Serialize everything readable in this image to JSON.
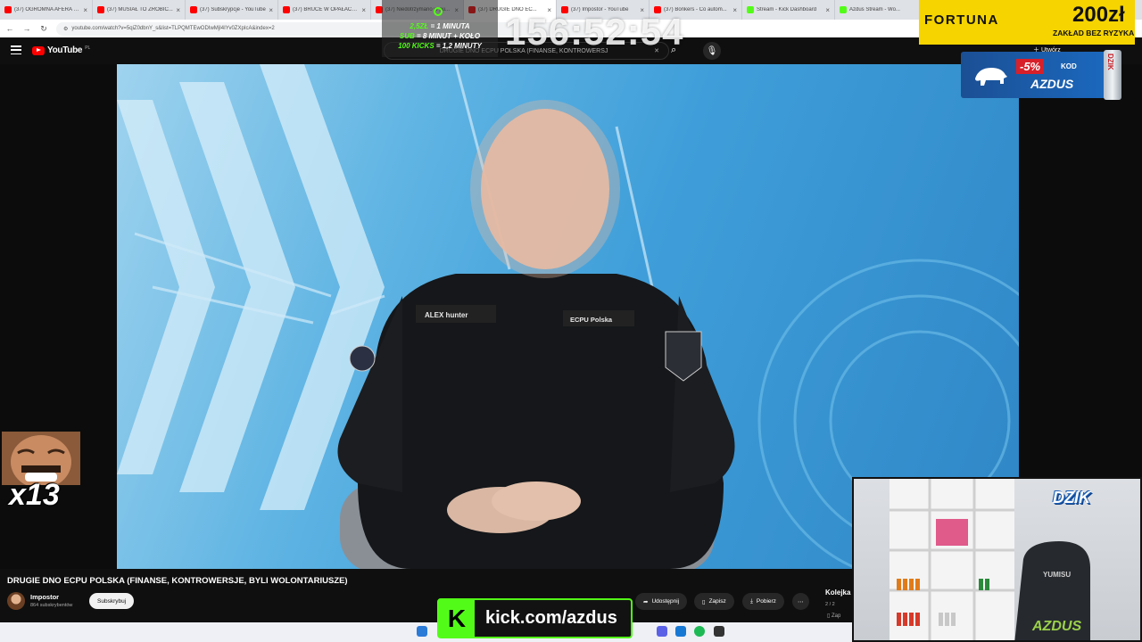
{
  "browser": {
    "tabs": [
      {
        "title": "(37) OGROMNA AFERA M...",
        "favicon": "youtube"
      },
      {
        "title": "(37) MUSIAŁ TO ZROBIĆ...",
        "favicon": "youtube"
      },
      {
        "title": "(37) Subskrypcje - YouTube",
        "favicon": "youtube"
      },
      {
        "title": "(37) BRUCE W OPAŁACH...",
        "favicon": "youtube"
      },
      {
        "title": "(37) Niedotrzymano w pu...",
        "favicon": "youtube"
      },
      {
        "title": "(37) DRUGIE DNO EC...",
        "favicon": "youtube"
      },
      {
        "title": "(37) Impostor - YouTube",
        "favicon": "youtube"
      },
      {
        "title": "(37) Bonkers - Co autom...",
        "favicon": "youtube"
      },
      {
        "title": "Stream - Kick Dashboard",
        "favicon": "kick"
      },
      {
        "title": "Azdus Stream - Wo...",
        "favicon": "kick"
      }
    ],
    "active_tab_index": 5,
    "url": "youtube.com/watch?v=5qiZ0dbnY_s&list=TLPQMTEwODIwMjI4IYv0ZXpIcA&index=2"
  },
  "youtube": {
    "logo_text": "YouTube",
    "logo_region": "PL",
    "search_query": "DRUGIE DNO ECPU POLSKA (FINANSE, KONTROWERSJ",
    "create_label": "Utwórz",
    "video_title": "DRUGIE DNO ECPU POLSKA (FINANSE, KONTROWERSJE, BYLI WOLONTARIUSZE)",
    "channel_name": "Impostor",
    "channel_subs": "864 subskrybentów",
    "subscribe_label": "Subskrybuj",
    "share_label": "Udostępnij",
    "save_label": "Zapisz",
    "download_label": "Pobierz",
    "more_label": "⋯",
    "queue_label": "Kolejka",
    "queue_position": "2 / 2",
    "queue_save_label": "Zap",
    "patch_left": "ALEX hunter",
    "patch_right": "ECPU Polska"
  },
  "overlay": {
    "goals": [
      {
        "prefix": "2,5ZŁ",
        "text": " = 1 MINUTA"
      },
      {
        "prefix": "SUB",
        "text": " = 8 MINUT + KOŁO"
      },
      {
        "prefix": "100 KICKS",
        "text": " = 1,2 MINUTY"
      }
    ],
    "timer": "156:52:54",
    "fortuna_brand": "FORTUNA",
    "fortuna_amount": "200zł",
    "fortuna_tagline": "ZAKŁAD BEZ RYZYKA",
    "promo_discount": "-5%",
    "promo_kod": "KOD",
    "promo_code": "AZDUS",
    "promo_can": "DZIK",
    "emote_count": "x13",
    "webcam_brand": "DZIK",
    "chair_brand_top": "YUMISU",
    "chair_brand_bottom": "AZDUS",
    "kick_icon": "K",
    "kick_url": "kick.com/azdus"
  },
  "colors": {
    "youtube_red": "#ff0000",
    "kick_green": "#53fc18",
    "fortuna_yellow": "#f5d400",
    "promo_blue": "#1b6bc2"
  }
}
